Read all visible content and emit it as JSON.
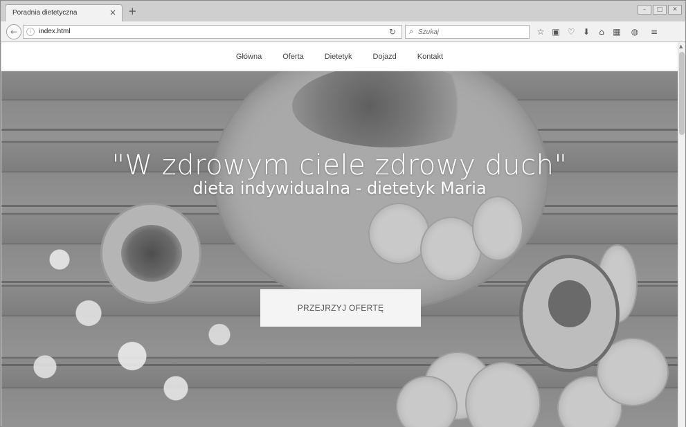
{
  "browser": {
    "tab_title": "Poradnia dietetyczna",
    "tab_close": "×",
    "new_tab": "+",
    "url": "index.html",
    "search_placeholder": "Szukaj",
    "window_controls": [
      "–",
      "□",
      "✕"
    ],
    "toolbar_icons": [
      "star-icon",
      "library-icon",
      "pocket-icon",
      "download-icon",
      "home-icon",
      "extension-icon",
      "addon-icon",
      "menu-icon"
    ]
  },
  "site": {
    "nav": [
      "Główna",
      "Oferta",
      "Dietetyk",
      "Dojazd",
      "Kontakt"
    ],
    "hero": {
      "title": "\"W zdrowym ciele zdrowy duch\"",
      "subtitle": "dieta indywidualna - dietetyk Maria",
      "cta": "PRZEJRZYJ OFERTĘ"
    }
  }
}
